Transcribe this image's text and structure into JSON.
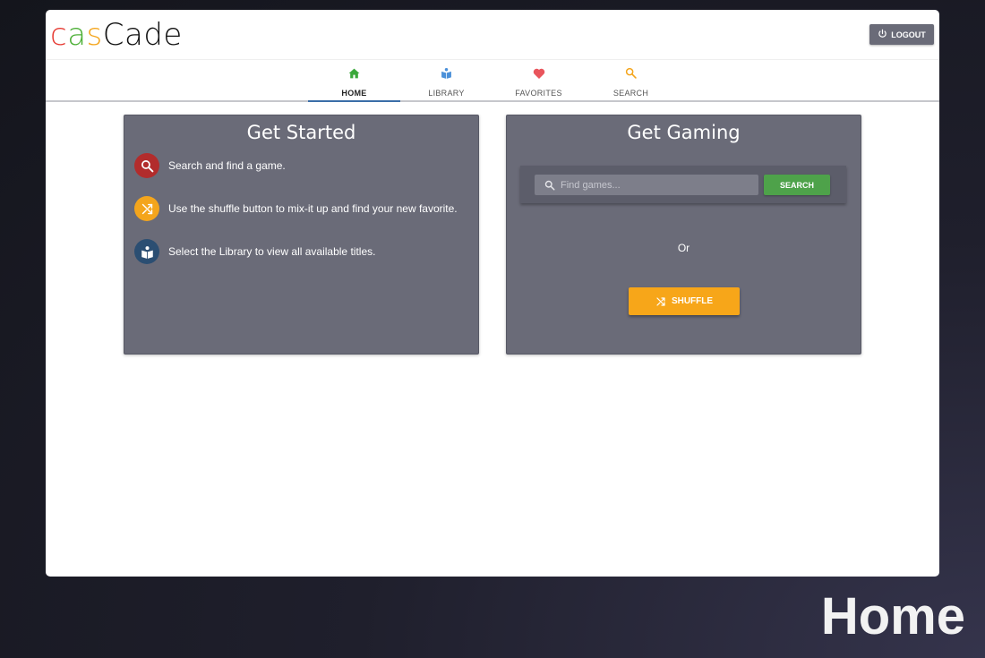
{
  "app": {
    "logo": {
      "c": "c",
      "a": "a",
      "s": "s",
      "rest": "Cade"
    },
    "logout_label": "LOGOUT"
  },
  "tabs": [
    {
      "label": "HOME",
      "icon": "home-icon",
      "color": "#3aa83a",
      "active": true
    },
    {
      "label": "LIBRARY",
      "icon": "book-reader-icon",
      "color": "#4a90d9",
      "active": false
    },
    {
      "label": "FAVORITES",
      "icon": "heart-icon",
      "color": "#e9555c",
      "active": false
    },
    {
      "label": "SEARCH",
      "icon": "search-icon",
      "color": "#f4a51c",
      "active": false
    }
  ],
  "get_started": {
    "title": "Get Started",
    "steps": [
      {
        "text": "Search and find a game.",
        "icon": "search-icon",
        "color": "#b22c2c"
      },
      {
        "text": "Use the shuffle button to mix-it up and find your new favorite.",
        "icon": "shuffle-icon",
        "color": "#f4a51c"
      },
      {
        "text": "Select the Library to view all available titles.",
        "icon": "book-reader-icon",
        "color": "#2b4e72"
      }
    ]
  },
  "get_gaming": {
    "title": "Get Gaming",
    "search_placeholder": "Find games...",
    "search_label": "SEARCH",
    "or_label": "Or",
    "shuffle_label": "SHUFFLE"
  },
  "caption": "Home",
  "colors": {
    "card_bg": "#6a6b78",
    "search_button": "#4ea24a",
    "shuffle_button": "#f7a619",
    "tab_underline": "#3b6ea8"
  }
}
